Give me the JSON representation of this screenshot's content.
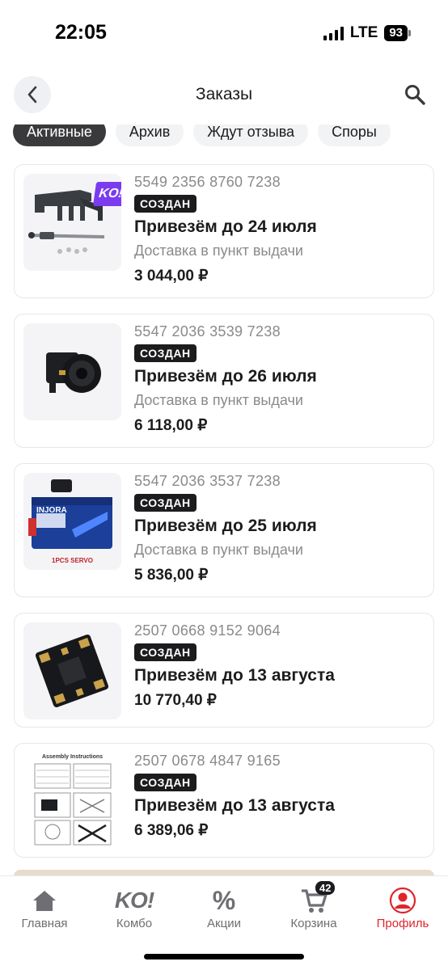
{
  "status_bar": {
    "time": "22:05",
    "network": "LTE",
    "battery": "93"
  },
  "header": {
    "title": "Заказы"
  },
  "tabs": [
    {
      "label": "Активные",
      "active": true
    },
    {
      "label": "Архив",
      "active": false
    },
    {
      "label": "Ждут отзыва",
      "active": false
    },
    {
      "label": "Споры",
      "active": false
    }
  ],
  "orders": [
    {
      "number": "5549 2356 8760 7238",
      "status": "СОЗДАН",
      "eta": "Привезём до 24 июля",
      "delivery": "Доставка в пункт выдачи",
      "price": "3 044,00 ₽",
      "image": "camera-mount-parts",
      "combo_badge": "KO!"
    },
    {
      "number": "5547 2036 3539 7238",
      "status": "СОЗДАН",
      "eta": "Привезём до 26 июля",
      "delivery": "Доставка в пункт выдачи",
      "price": "6 118,00 ₽",
      "image": "fpv-camera"
    },
    {
      "number": "5547 2036 3537 7238",
      "status": "СОЗДАН",
      "eta": "Привезём до 25 июля",
      "delivery": "Доставка в пункт выдачи",
      "price": "5 836,00 ₽",
      "image": "servo-motor",
      "image_text": {
        "brand": "INJORA",
        "caption": "1PCS SERVO"
      }
    },
    {
      "number": "2507 0668 9152 9064",
      "status": "СОЗДАН",
      "eta": "Привезём до 13 августа",
      "price": "10 770,40 ₽",
      "image": "esc-board"
    },
    {
      "number": "2507 0678 4847 9165",
      "status": "СОЗДАН",
      "eta": "Привезём до 13 августа",
      "price": "6 389,06 ₽",
      "image": "assembly-instructions",
      "image_text": {
        "heading": "Assembly Instructions"
      }
    }
  ],
  "tabbar": [
    {
      "label": "Главная",
      "icon": "home-icon",
      "active": false
    },
    {
      "label": "Комбо",
      "icon": "ko-logo-icon",
      "active": false
    },
    {
      "label": "Акции",
      "icon": "percent-icon",
      "active": false
    },
    {
      "label": "Корзина",
      "icon": "cart-icon",
      "active": false,
      "badge": "42"
    },
    {
      "label": "Профиль",
      "icon": "profile-icon",
      "active": true
    }
  ],
  "colors": {
    "accent": "#e0252b",
    "badge_bg": "#1c1c1e",
    "tab_active_bg": "#3a3a3c"
  }
}
